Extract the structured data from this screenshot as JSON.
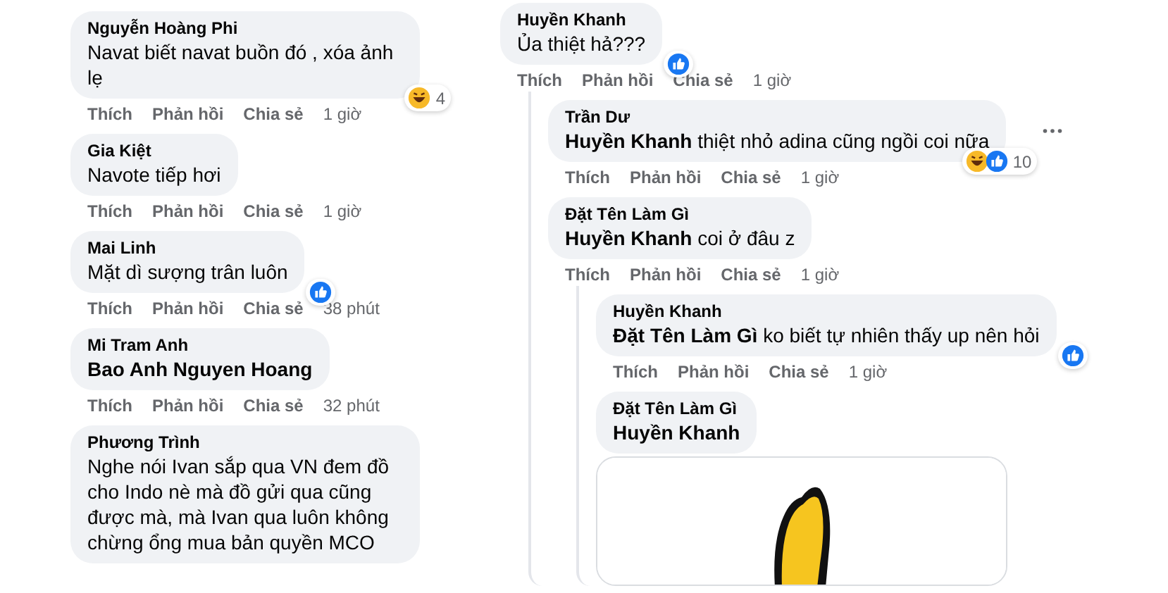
{
  "left_comments": [
    {
      "name": "Nguyễn Hoàng Phi",
      "text": "Navat biết navat buồn đó , xóa ảnh lẹ",
      "reactions": [
        {
          "kind": "haha"
        }
      ],
      "reaction_count": "4",
      "actions": [
        "Thích",
        "Phản hồi",
        "Chia sẻ"
      ],
      "time": "1 giờ"
    },
    {
      "name": "Gia Kiệt",
      "text": "Navote tiếp hơi",
      "actions": [
        "Thích",
        "Phản hồi",
        "Chia sẻ"
      ],
      "time": "1 giờ"
    },
    {
      "name": "Mai Linh",
      "text": "Mặt dì sượng trân luôn",
      "reactions": [
        {
          "kind": "like"
        }
      ],
      "actions": [
        "Thích",
        "Phản hồi",
        "Chia sẻ"
      ],
      "time": "38 phút"
    },
    {
      "name": "Mi Tram Anh",
      "mention": "Bao Anh Nguyen Hoang",
      "actions": [
        "Thích",
        "Phản hồi",
        "Chia sẻ"
      ],
      "time": "32 phút"
    },
    {
      "name": "Phương Trình",
      "text": "Nghe nói Ivan sắp qua VN đem đồ cho Indo nè mà đồ gửi qua cũng được mà, mà Ivan qua luôn không chừng ổng mua bản quyền MCO"
    }
  ],
  "right_thread": {
    "name": "Huyền Khanh",
    "text": "Ủa thiệt hả???",
    "reactions": [
      {
        "kind": "like"
      }
    ],
    "actions": [
      "Thích",
      "Phản hồi",
      "Chia sẻ"
    ],
    "time": "1 giờ",
    "children": [
      {
        "name": "Trần Dư",
        "mention": "Huyền Khanh",
        "text": "thiệt nhỏ adina cũng ngồi coi nữa",
        "reactions": [
          {
            "kind": "haha"
          },
          {
            "kind": "like"
          }
        ],
        "reaction_count": "10",
        "menu_button": true,
        "actions": [
          "Thích",
          "Phản hồi",
          "Chia sẻ"
        ],
        "time": "1 giờ"
      },
      {
        "name": "Đặt Tên Làm Gì",
        "mention": "Huyền Khanh",
        "text": "coi ở đâu z",
        "actions": [
          "Thích",
          "Phản hồi",
          "Chia sẻ"
        ],
        "time": "1 giờ",
        "children": [
          {
            "name": "Huyền Khanh",
            "mention": "Đặt Tên Làm Gì",
            "text": "ko biết tự nhiên thấy up nên hỏi",
            "reactions": [
              {
                "kind": "like"
              }
            ],
            "actions": [
              "Thích",
              "Phản hồi",
              "Chia sẻ"
            ],
            "time": "1 giờ"
          },
          {
            "name": "Đặt Tên Làm Gì",
            "mention": "Huyền Khanh"
          }
        ]
      }
    ]
  }
}
